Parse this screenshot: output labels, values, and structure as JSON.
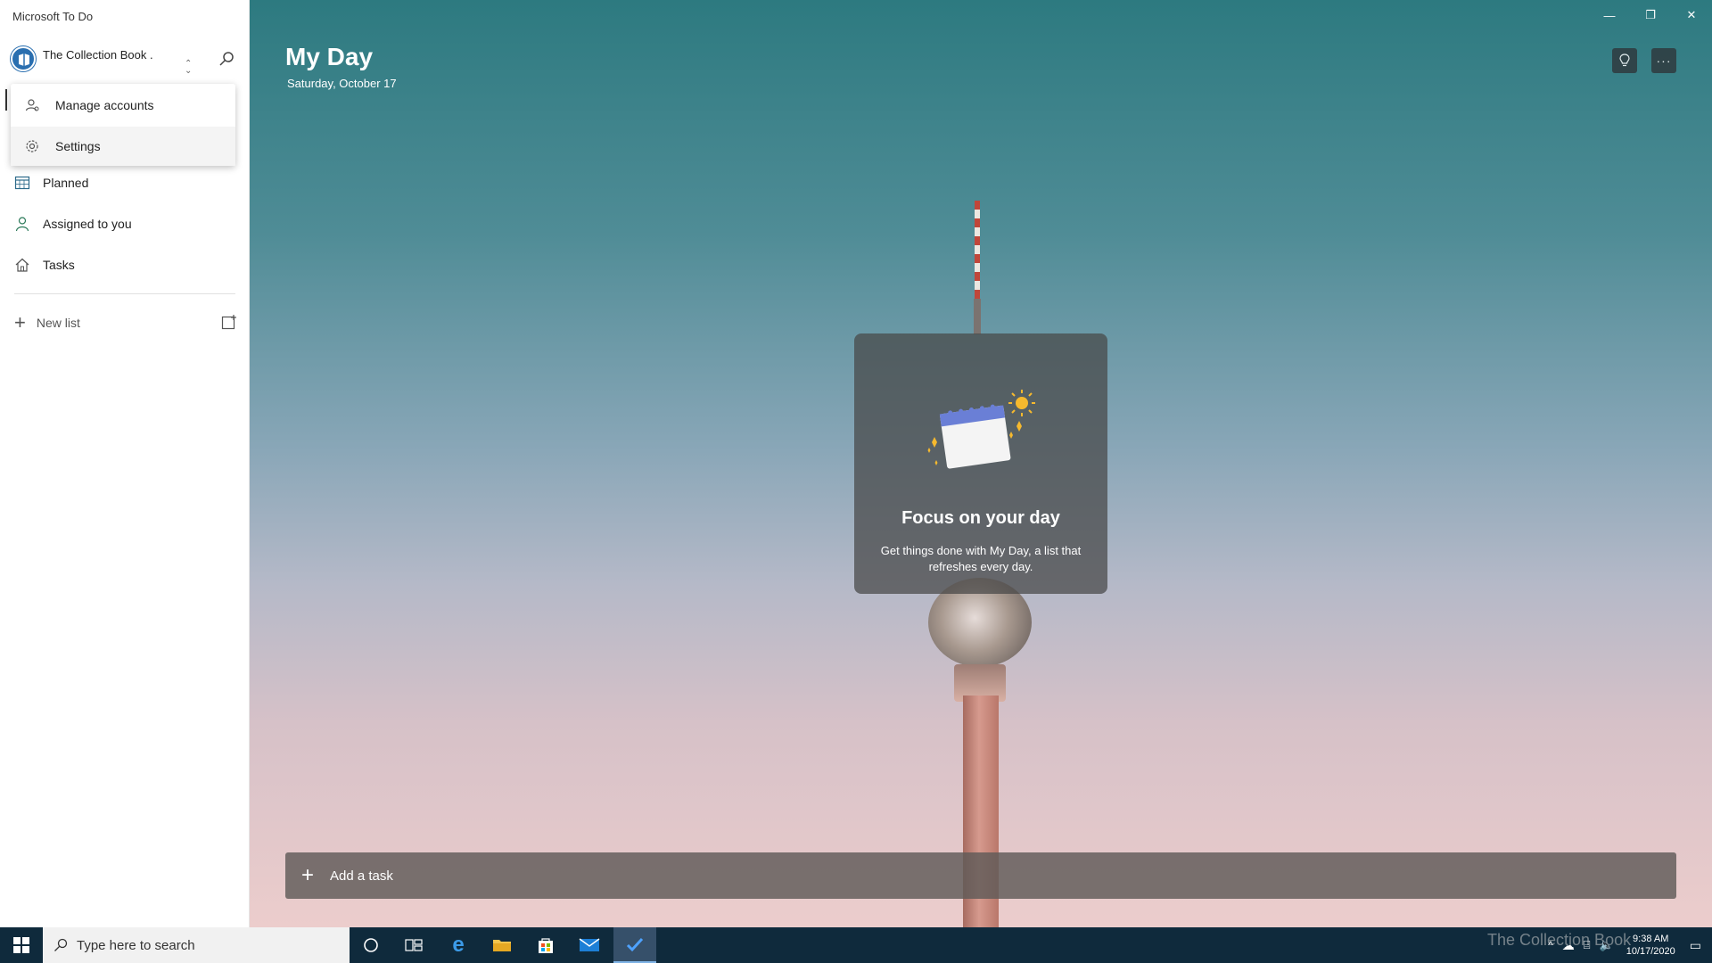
{
  "app": {
    "title": "Microsoft To Do"
  },
  "account": {
    "name": "The Collection Book ."
  },
  "account_menu": {
    "items": [
      {
        "label": "Manage accounts",
        "icon": "manage-accounts-icon"
      },
      {
        "label": "Settings",
        "icon": "gear-icon"
      }
    ]
  },
  "sidebar": {
    "items": [
      {
        "label": "Planned",
        "icon": "calendar-icon"
      },
      {
        "label": "Assigned to you",
        "icon": "person-icon"
      },
      {
        "label": "Tasks",
        "icon": "home-icon"
      }
    ],
    "new_list_label": "New list"
  },
  "main": {
    "title": "My Day",
    "date": "Saturday, October 17",
    "focus_card": {
      "title": "Focus on your day",
      "body": "Get things done with My Day, a list that refreshes every day."
    },
    "add_task_label": "Add a task"
  },
  "taskbar": {
    "search_placeholder": "Type here to search",
    "clock_time": "9:38 AM",
    "clock_date": "10/17/2020",
    "watermark": "The Collection Book"
  },
  "colors": {
    "accent": "#2a6fb0",
    "taskbar": "#0f2a3c"
  }
}
